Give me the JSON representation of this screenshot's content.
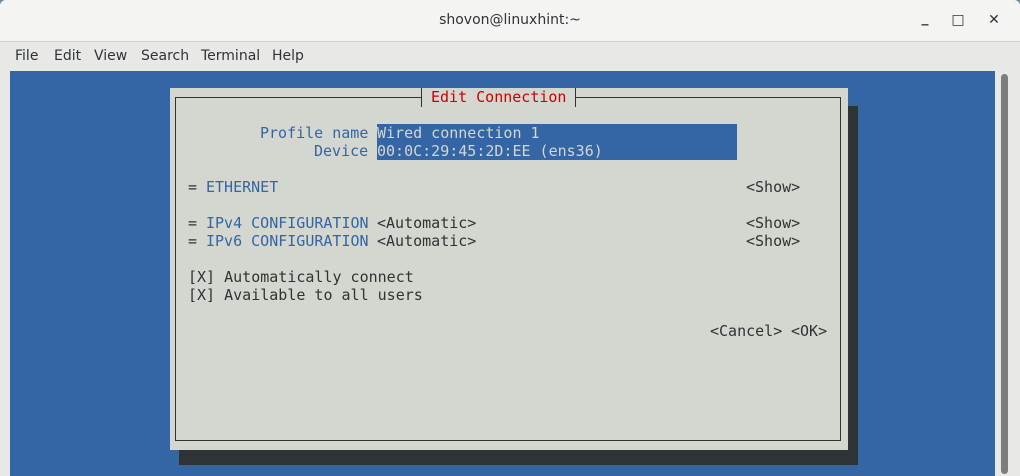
{
  "window": {
    "title": "shovon@linuxhint:~",
    "minimize": "_",
    "maximize": "□",
    "close": "✕"
  },
  "menu": [
    "File",
    "Edit",
    "View",
    "Search",
    "Terminal",
    "Help"
  ],
  "dialog": {
    "title": "Edit Connection",
    "profile_label": "Profile name",
    "profile_value": "Wired connection 1",
    "device_label": "Device",
    "device_value": "00:0C:29:45:2D:EE (ens36)",
    "ethernet": "ETHERNET",
    "ipv4": "IPv4 CONFIGURATION",
    "ipv6": "IPv6 CONFIGURATION",
    "section_marker": "=",
    "automatic": "<Automatic>",
    "show": "<Show>",
    "auto_connect": "[X] Automatically connect",
    "all_users": "[X] Available to all users",
    "cancel": "<Cancel>",
    "ok": "<OK>"
  },
  "colors": {
    "terminal_bg": "#3465a4",
    "dialog_bg": "#d3d7cf",
    "title": "#cc0000"
  }
}
